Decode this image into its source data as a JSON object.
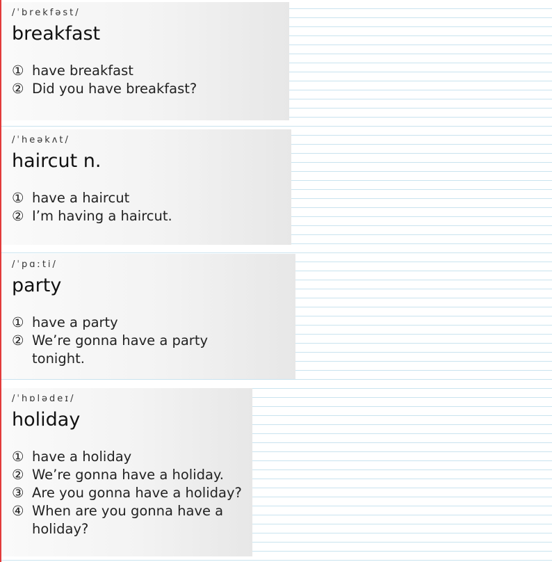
{
  "cards": [
    {
      "phonetic": "/ˈbrekfəst/",
      "word": "breakfast",
      "examples": [
        {
          "num": "①",
          "text": "have breakfast"
        },
        {
          "num": "②",
          "text": "Did you have breakfast?"
        }
      ]
    },
    {
      "phonetic": "/ˈheəkʌt/",
      "word": "haircut n.",
      "examples": [
        {
          "num": "①",
          "text": "have a haircut"
        },
        {
          "num": "②",
          "text": "I’m having a haircut."
        }
      ]
    },
    {
      "phonetic": "/ˈpɑːti/",
      "word": "party",
      "examples": [
        {
          "num": "①",
          "text": "have a party"
        },
        {
          "num": "②",
          "text": "We’re gonna have a party tonight."
        }
      ]
    },
    {
      "phonetic": "/ˈhɒlədeɪ/",
      "word": "holiday",
      "examples": [
        {
          "num": "①",
          "text": "have a holiday"
        },
        {
          "num": "②",
          "text": "We’re gonna have a holiday."
        },
        {
          "num": "③",
          "text": "Are you gonna have a holiday?"
        },
        {
          "num": "④",
          "text": "When are you gonna have a holiday?"
        }
      ]
    }
  ]
}
